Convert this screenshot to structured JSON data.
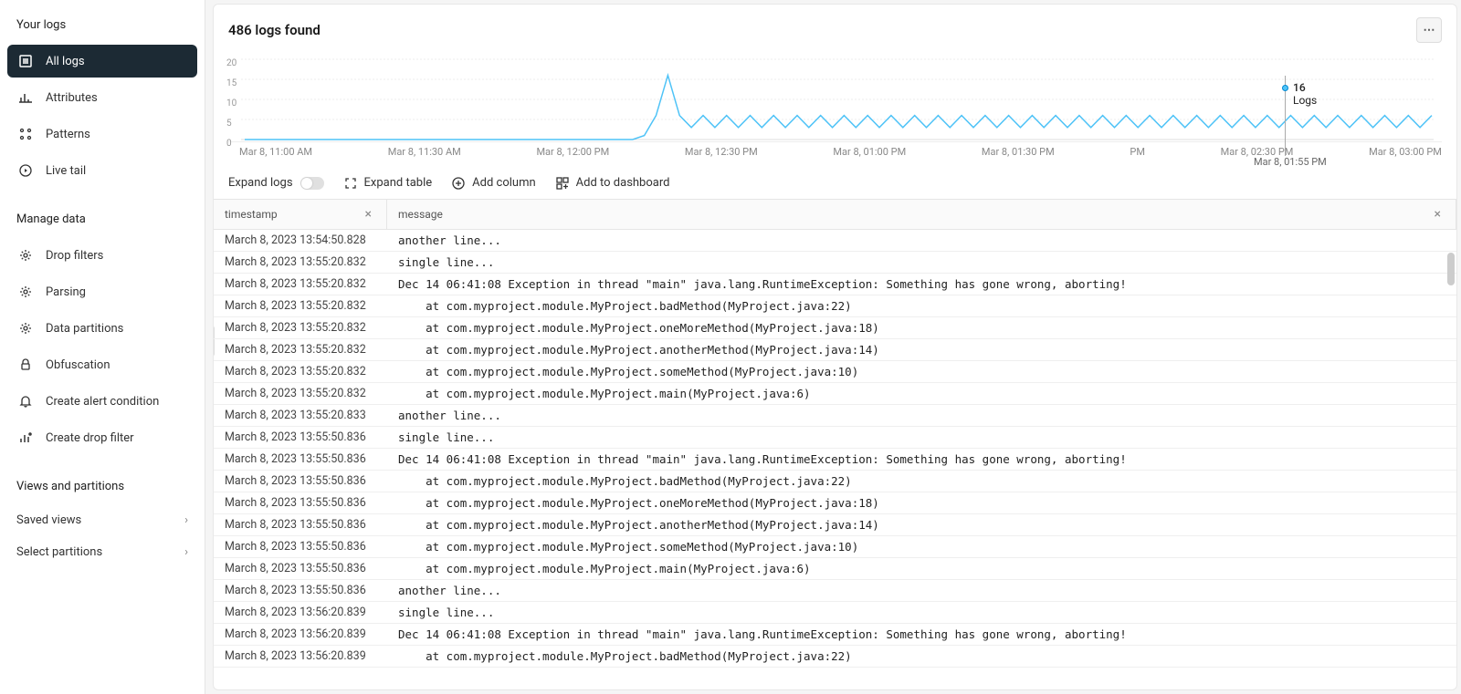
{
  "sidebar": {
    "section1_title": "Your logs",
    "section2_title": "Manage data",
    "section3_title": "Views and partitions",
    "your_logs_items": [
      {
        "label": "All logs",
        "active": true
      },
      {
        "label": "Attributes",
        "active": false
      },
      {
        "label": "Patterns",
        "active": false
      },
      {
        "label": "Live tail",
        "active": false
      }
    ],
    "manage_data_items": [
      {
        "label": "Drop filters"
      },
      {
        "label": "Parsing"
      },
      {
        "label": "Data partitions"
      },
      {
        "label": "Obfuscation"
      },
      {
        "label": "Create alert condition"
      },
      {
        "label": "Create drop filter"
      }
    ],
    "views_items": [
      {
        "label": "Saved views"
      },
      {
        "label": "Select partitions"
      }
    ]
  },
  "header": {
    "logs_found": "486 logs found"
  },
  "toolbar": {
    "expand_logs": "Expand logs",
    "expand_table": "Expand table",
    "add_column": "Add column",
    "add_to_dashboard": "Add to dashboard"
  },
  "table": {
    "col_timestamp": "timestamp",
    "col_message": "message",
    "rows": [
      {
        "ts": "March 8, 2023 13:54:50.828",
        "msg": "another line..."
      },
      {
        "ts": "March 8, 2023 13:55:20.832",
        "msg": "single line..."
      },
      {
        "ts": "March 8, 2023 13:55:20.832",
        "msg": "Dec 14 06:41:08 Exception in thread \"main\" java.lang.RuntimeException: Something has gone wrong, aborting!"
      },
      {
        "ts": "March 8, 2023 13:55:20.832",
        "msg": "    at com.myproject.module.MyProject.badMethod(MyProject.java:22)"
      },
      {
        "ts": "March 8, 2023 13:55:20.832",
        "msg": "    at com.myproject.module.MyProject.oneMoreMethod(MyProject.java:18)"
      },
      {
        "ts": "March 8, 2023 13:55:20.832",
        "msg": "    at com.myproject.module.MyProject.anotherMethod(MyProject.java:14)"
      },
      {
        "ts": "March 8, 2023 13:55:20.832",
        "msg": "    at com.myproject.module.MyProject.someMethod(MyProject.java:10)"
      },
      {
        "ts": "March 8, 2023 13:55:20.832",
        "msg": "    at com.myproject.module.MyProject.main(MyProject.java:6)"
      },
      {
        "ts": "March 8, 2023 13:55:20.833",
        "msg": "another line..."
      },
      {
        "ts": "March 8, 2023 13:55:50.836",
        "msg": "single line..."
      },
      {
        "ts": "March 8, 2023 13:55:50.836",
        "msg": "Dec 14 06:41:08 Exception in thread \"main\" java.lang.RuntimeException: Something has gone wrong, aborting!"
      },
      {
        "ts": "March 8, 2023 13:55:50.836",
        "msg": "    at com.myproject.module.MyProject.badMethod(MyProject.java:22)"
      },
      {
        "ts": "March 8, 2023 13:55:50.836",
        "msg": "    at com.myproject.module.MyProject.oneMoreMethod(MyProject.java:18)"
      },
      {
        "ts": "March 8, 2023 13:55:50.836",
        "msg": "    at com.myproject.module.MyProject.anotherMethod(MyProject.java:14)"
      },
      {
        "ts": "March 8, 2023 13:55:50.836",
        "msg": "    at com.myproject.module.MyProject.someMethod(MyProject.java:10)"
      },
      {
        "ts": "March 8, 2023 13:55:50.836",
        "msg": "    at com.myproject.module.MyProject.main(MyProject.java:6)"
      },
      {
        "ts": "March 8, 2023 13:55:50.836",
        "msg": "another line..."
      },
      {
        "ts": "March 8, 2023 13:56:20.839",
        "msg": "single line..."
      },
      {
        "ts": "March 8, 2023 13:56:20.839",
        "msg": "Dec 14 06:41:08 Exception in thread \"main\" java.lang.RuntimeException: Something has gone wrong, aborting!"
      },
      {
        "ts": "March 8, 2023 13:56:20.839",
        "msg": "    at com.myproject.module.MyProject.badMethod(MyProject.java:22)"
      }
    ]
  },
  "chart_data": {
    "type": "line",
    "title": "",
    "xlabel": "",
    "ylabel": "",
    "ylim": [
      0,
      20
    ],
    "y_ticks": [
      0,
      5,
      10,
      15,
      20
    ],
    "x_tick_labels": [
      "Mar 8, 11:00 AM",
      "Mar 8, 11:30 AM",
      "Mar 8, 12:00 PM",
      "Mar 8, 12:30 PM",
      "Mar 8, 01:00 PM",
      "Mar 8, 01:30 PM",
      "PM",
      "Mar 8, 02:30 PM",
      "Mar 8, 03:00 PM"
    ],
    "line_color": "#4fc3f7",
    "series": [
      {
        "name": "Logs",
        "x": [
          "11:00",
          "11:05",
          "11:10",
          "11:15",
          "11:20",
          "11:25",
          "11:30",
          "11:35",
          "11:40",
          "11:45",
          "11:50",
          "11:55",
          "12:00",
          "12:05",
          "12:10",
          "12:15",
          "12:20",
          "12:25",
          "12:30",
          "12:35",
          "12:40",
          "12:45",
          "12:50",
          "12:55",
          "13:00",
          "13:05",
          "13:10",
          "13:15",
          "13:20",
          "13:25",
          "13:30",
          "13:35",
          "13:40",
          "13:45",
          "13:50",
          "13:54",
          "13:55",
          "13:56",
          "13:57",
          "13:58",
          "13:59",
          "14:00",
          "14:01",
          "14:02",
          "14:03",
          "14:04",
          "14:05",
          "14:06",
          "14:07",
          "14:08",
          "14:09",
          "14:10",
          "14:11",
          "14:12",
          "14:13",
          "14:14",
          "14:15",
          "14:16",
          "14:17",
          "14:18",
          "14:19",
          "14:20",
          "14:21",
          "14:22",
          "14:23",
          "14:24",
          "14:25",
          "14:26",
          "14:27",
          "14:28",
          "14:29",
          "14:30",
          "14:31",
          "14:32",
          "14:33",
          "14:34",
          "14:35",
          "14:36",
          "14:37",
          "14:38",
          "14:39",
          "14:40",
          "14:41",
          "14:42",
          "14:43",
          "14:44",
          "14:45",
          "14:46",
          "14:47",
          "14:48",
          "14:49",
          "14:50",
          "14:51",
          "14:52",
          "14:53",
          "14:54",
          "14:55",
          "14:56",
          "14:57",
          "14:58",
          "14:59",
          "15:00"
        ],
        "values": [
          0,
          0,
          0,
          0,
          0,
          0,
          0,
          0,
          0,
          0,
          0,
          0,
          0,
          0,
          0,
          0,
          0,
          0,
          0,
          0,
          0,
          0,
          0,
          0,
          0,
          0,
          0,
          0,
          0,
          0,
          0,
          0,
          0,
          0,
          1,
          6,
          16,
          6,
          3,
          6,
          3,
          6,
          3,
          6,
          3,
          6,
          3,
          6,
          3,
          6,
          3,
          6,
          3,
          6,
          3,
          6,
          3,
          6,
          3,
          6,
          3,
          6,
          3,
          6,
          3,
          6,
          3,
          6,
          3,
          6,
          3,
          6,
          3,
          6,
          3,
          6,
          3,
          6,
          3,
          6,
          3,
          6,
          3,
          6,
          3,
          6,
          3,
          6,
          3,
          6,
          3,
          6,
          3,
          6,
          3,
          6,
          3,
          6,
          3,
          6,
          3,
          6
        ]
      }
    ],
    "hover": {
      "x": "Mar 8, 01:55 PM",
      "value": 16,
      "label": "Logs"
    }
  }
}
